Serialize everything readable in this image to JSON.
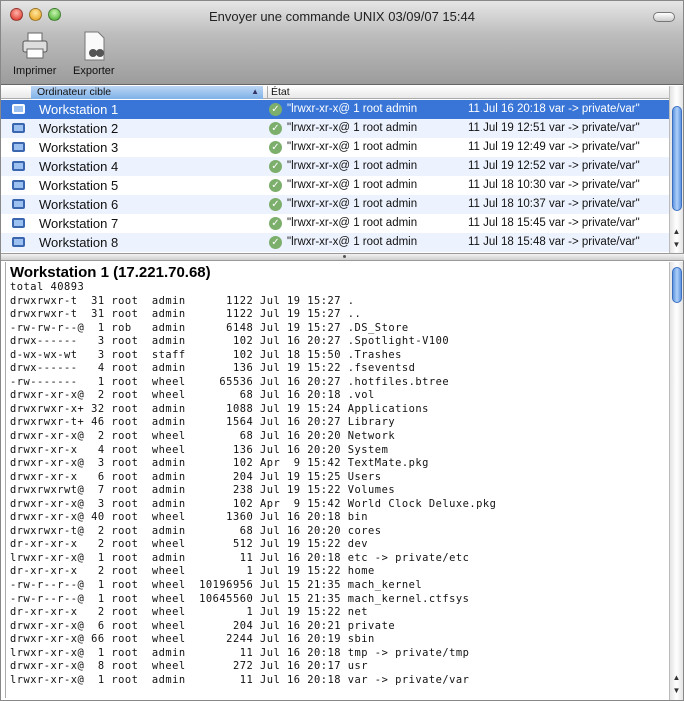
{
  "window": {
    "title": "Envoyer une commande UNIX  03/09/07 15:44"
  },
  "toolbar": {
    "print_label": "Imprimer",
    "export_label": "Exporter"
  },
  "table": {
    "columns": [
      "Ordinateur cible",
      "État"
    ],
    "rows": [
      {
        "name": "Workstation 1",
        "status": "\"lrwxr-xr-x@  1 root  admin",
        "detail": "11 Jul 16 20:18 var -> private/var\"",
        "selected": true
      },
      {
        "name": "Workstation 2",
        "status": "\"lrwxr-xr-x@  1 root  admin",
        "detail": "11 Jul 19 12:51 var -> private/var\""
      },
      {
        "name": "Workstation 3",
        "status": "\"lrwxr-xr-x@  1 root   admin",
        "detail": "11 Jul 19 12:49 var -> private/var\""
      },
      {
        "name": "Workstation 4",
        "status": "\"lrwxr-xr-x@  1 root  admin",
        "detail": "11 Jul 19 12:52 var -> private/var\""
      },
      {
        "name": "Workstation 5",
        "status": "\"lrwxr-xr-x@  1 root  admin",
        "detail": "11 Jul 18 10:30 var -> private/var\""
      },
      {
        "name": "Workstation 6",
        "status": "\"lrwxr-xr-x@  1 root  admin",
        "detail": "11 Jul 18 10:37 var -> private/var\""
      },
      {
        "name": "Workstation 7",
        "status": "\"lrwxr-xr-x@  1 root  admin",
        "detail": "11 Jul 18 15:45 var -> private/var\""
      },
      {
        "name": "Workstation 8",
        "status": "\"lrwxr-xr-x@  1 root  admin",
        "detail": "11 Jul 18 15:48 var -> private/var\""
      }
    ]
  },
  "output": {
    "heading": "Workstation 1 (17.221.70.68)",
    "lines": [
      "total 40893",
      "drwxrwxr-t  31 root  admin      1122 Jul 19 15:27 .",
      "drwxrwxr-t  31 root  admin      1122 Jul 19 15:27 ..",
      "-rw-rw-r--@  1 rob   admin      6148 Jul 19 15:27 .DS_Store",
      "drwx------   3 root  admin       102 Jul 16 20:27 .Spotlight-V100",
      "d-wx-wx-wt   3 root  staff       102 Jul 18 15:50 .Trashes",
      "drwx------   4 root  admin       136 Jul 19 15:22 .fseventsd",
      "-rw-------   1 root  wheel     65536 Jul 16 20:27 .hotfiles.btree",
      "drwxr-xr-x@  2 root  wheel        68 Jul 16 20:18 .vol",
      "drwxrwxr-x+ 32 root  admin      1088 Jul 19 15:24 Applications",
      "drwxrwxr-t+ 46 root  admin      1564 Jul 16 20:27 Library",
      "drwxr-xr-x@  2 root  wheel        68 Jul 16 20:20 Network",
      "drwxr-xr-x   4 root  wheel       136 Jul 16 20:20 System",
      "drwxr-xr-x@  3 root  admin       102 Apr  9 15:42 TextMate.pkg",
      "drwxr-xr-x   6 root  admin       204 Jul 19 15:25 Users",
      "drwxrwxrwt@  7 root  admin       238 Jul 19 15:22 Volumes",
      "drwxr-xr-x@  3 root  admin       102 Apr  9 15:42 World Clock Deluxe.pkg",
      "drwxr-xr-x@ 40 root  wheel      1360 Jul 16 20:18 bin",
      "drwxrwxr-t@  2 root  admin        68 Jul 16 20:20 cores",
      "dr-xr-xr-x   2 root  wheel       512 Jul 19 15:22 dev",
      "lrwxr-xr-x@  1 root  admin        11 Jul 16 20:18 etc -> private/etc",
      "dr-xr-xr-x   2 root  wheel         1 Jul 19 15:22 home",
      "-rw-r--r--@  1 root  wheel  10196956 Jul 15 21:35 mach_kernel",
      "-rw-r--r--@  1 root  wheel  10645560 Jul 15 21:35 mach_kernel.ctfsys",
      "dr-xr-xr-x   2 root  wheel         1 Jul 19 15:22 net",
      "drwxr-xr-x@  6 root  wheel       204 Jul 16 20:21 private",
      "drwxr-xr-x@ 66 root  wheel      2244 Jul 16 20:19 sbin",
      "lrwxr-xr-x@  1 root  admin        11 Jul 16 20:18 tmp -> private/tmp",
      "drwxr-xr-x@  8 root  wheel       272 Jul 16 20:17 usr",
      "lrwxr-xr-x@  1 root  admin        11 Jul 16 20:18 var -> private/var"
    ]
  }
}
